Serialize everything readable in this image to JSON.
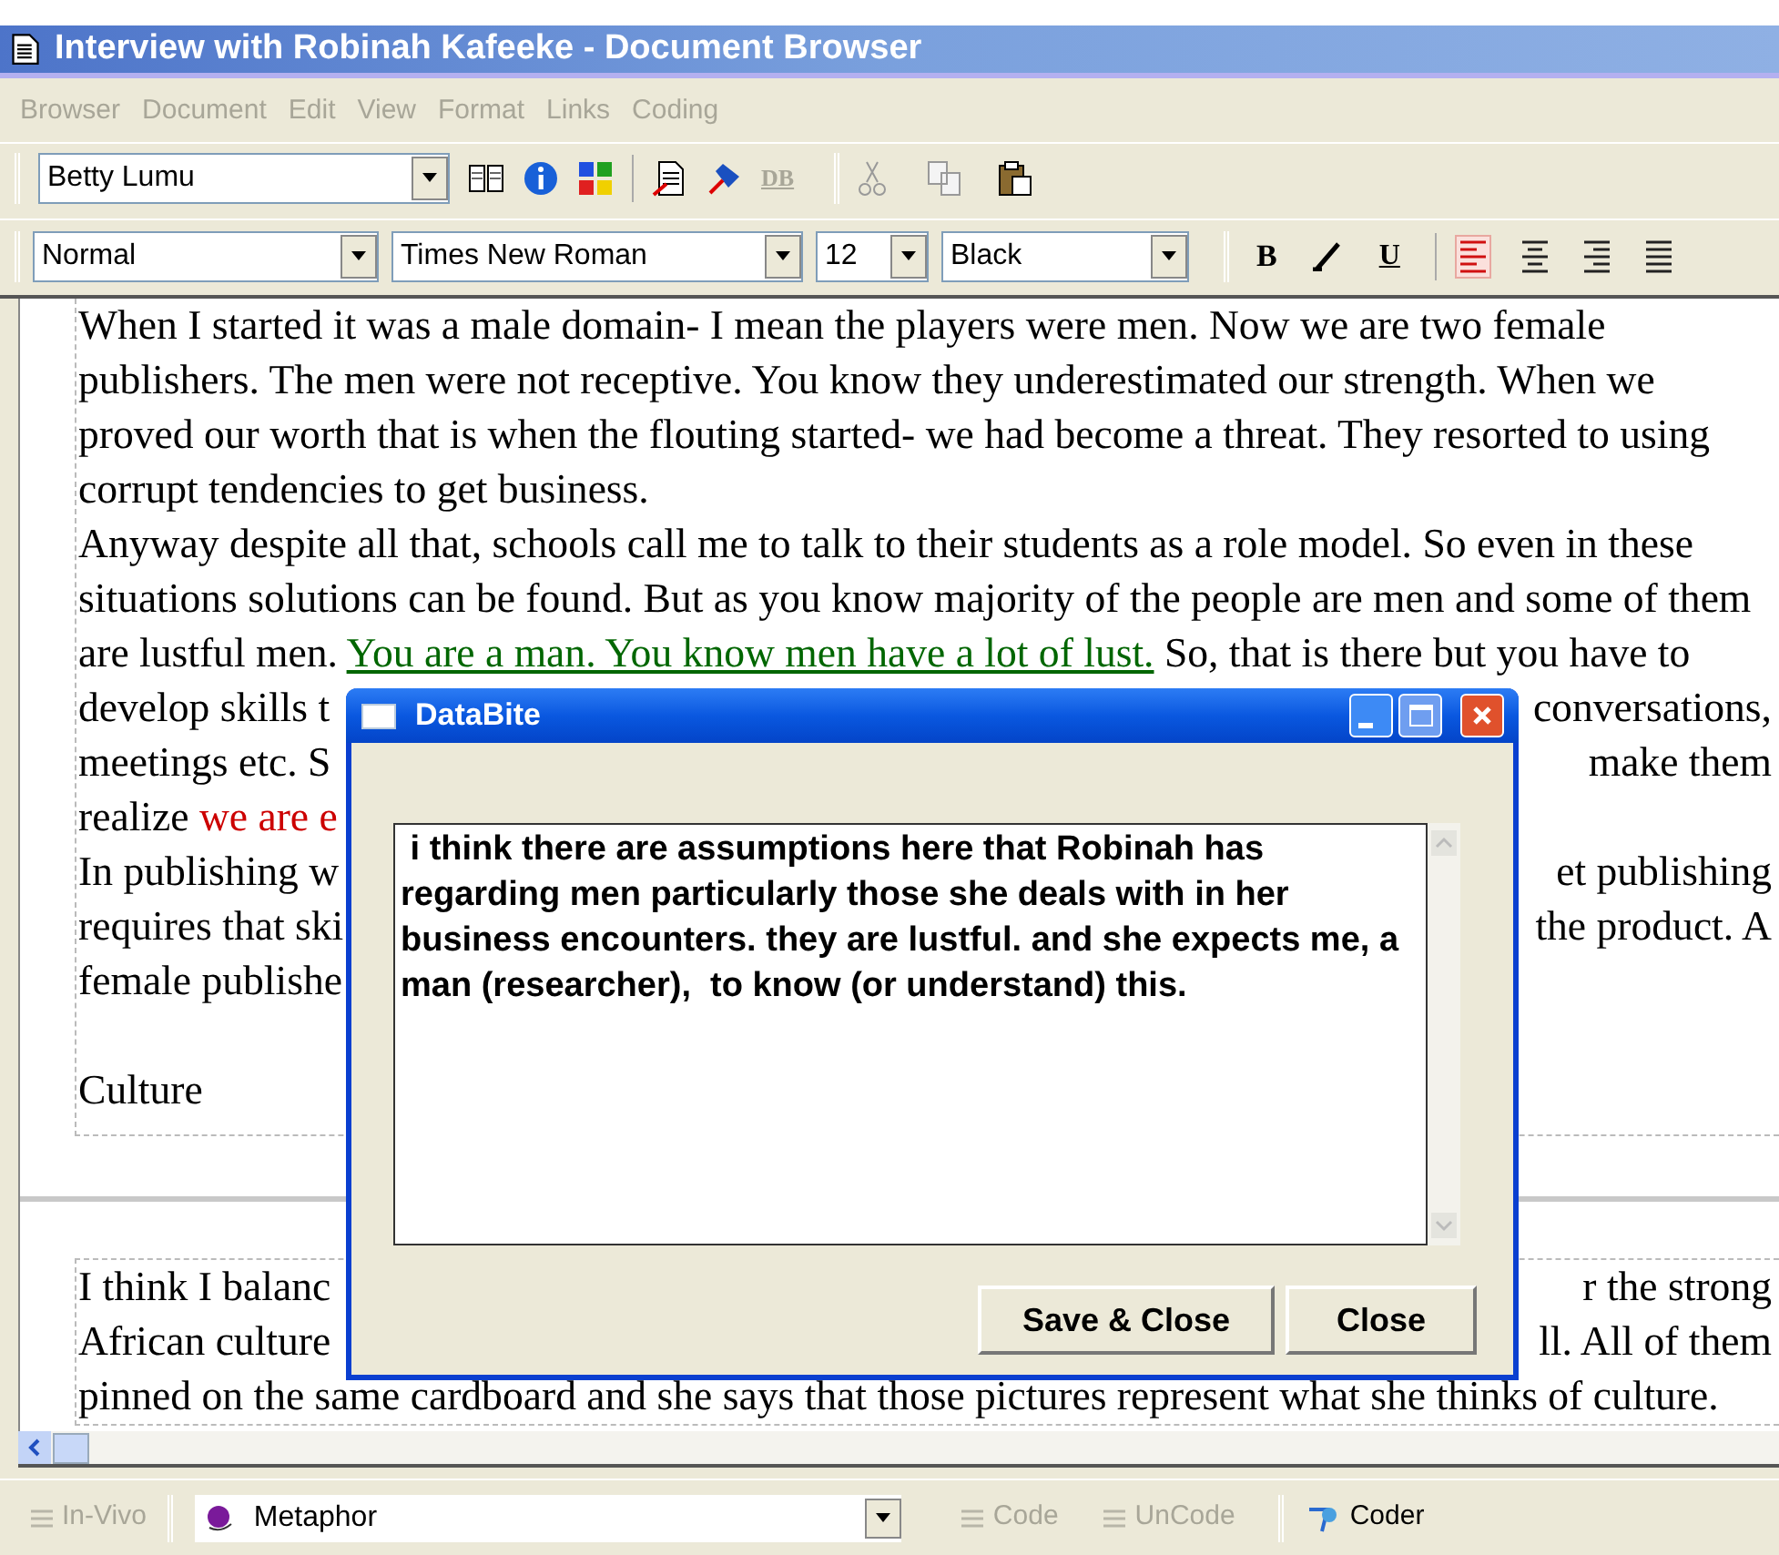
{
  "window": {
    "title": "Interview with Robinah Kafeeke - Document Browser"
  },
  "menu": [
    {
      "label": "Browser",
      "disabled": true
    },
    {
      "label": "Document",
      "disabled": true
    },
    {
      "label": "Edit",
      "disabled": true
    },
    {
      "label": "View",
      "disabled": true
    },
    {
      "label": "Format",
      "disabled": true
    },
    {
      "label": "Links",
      "disabled": true
    },
    {
      "label": "Coding",
      "disabled": true
    }
  ],
  "toolbar": {
    "user": "Betty Lumu",
    "db_button": {
      "label": "DB",
      "disabled": true
    }
  },
  "format_bar": {
    "style": "Normal",
    "font": "Times New Roman",
    "size": "12",
    "font_color_name": "Black",
    "bold": "B",
    "underline": "U",
    "alignment": [
      {
        "kind": "left",
        "selected": true
      },
      {
        "kind": "center",
        "selected": false
      },
      {
        "kind": "right",
        "selected": false
      },
      {
        "kind": "justify",
        "selected": false
      }
    ]
  },
  "document": {
    "blocks": [
      {
        "lines": [
          {
            "kind": "text",
            "left": [
              {
                "text": "When I started it was a male domain- I mean the players were men. Now we are two female"
              }
            ]
          },
          {
            "kind": "text",
            "left": [
              {
                "text": "publishers. The men were not receptive. You know they underestimated our strength. When we"
              }
            ]
          },
          {
            "kind": "text",
            "left": [
              {
                "text": "proved our worth that is when the flouting started- we had become a threat. They resorted to using"
              }
            ]
          },
          {
            "kind": "text",
            "left": [
              {
                "text": "corrupt tendencies to get business."
              }
            ]
          },
          {
            "kind": "text",
            "left": [
              {
                "text": "Anyway despite all that, schools call me to talk to their students as a role model. So even in these"
              }
            ]
          },
          {
            "kind": "text",
            "left": [
              {
                "text": "situations solutions can be found. But as you know majority of the people are men and some of them"
              }
            ]
          },
          {
            "kind": "text",
            "left": [
              {
                "text": "are lustful men. "
              },
              {
                "text": "You are a man. You know men have a lot of lust.",
                "color": "#006600"
              },
              {
                "text": " So, that is there but you have to"
              }
            ]
          },
          {
            "kind": "text",
            "left": [
              {
                "text": "develop skills t"
              }
            ],
            "right": "conversations,"
          },
          {
            "kind": "text",
            "left": [
              {
                "text": "meetings etc. S"
              }
            ],
            "right": "make them"
          },
          {
            "kind": "text",
            "left": [
              {
                "text": "realize "
              },
              {
                "text": "we are e",
                "color": "#cc0000"
              }
            ]
          },
          {
            "kind": "text",
            "left": [
              {
                "text": "In publishing w"
              }
            ],
            "right": "et publishing"
          },
          {
            "kind": "text",
            "left": [
              {
                "text": "requires that ski"
              }
            ],
            "right": "the product. A"
          },
          {
            "kind": "text",
            "left": [
              {
                "text": "female publishe"
              }
            ]
          },
          {
            "kind": "blank"
          },
          {
            "kind": "text",
            "left": [
              {
                "text": "Culture"
              }
            ]
          }
        ]
      },
      {
        "lines": [
          {
            "kind": "text",
            "left": [
              {
                "text": "I think  I balanc"
              }
            ],
            "right": "r the strong"
          },
          {
            "kind": "text",
            "left": [
              {
                "text": "African culture"
              }
            ],
            "right": "ll. All of them"
          },
          {
            "kind": "text",
            "left": [
              {
                "text": "pinned on the same cardboard and she says that those pictures represent what she thinks of culture."
              }
            ]
          }
        ]
      }
    ]
  },
  "dialog": {
    "title": "DataBite",
    "note": " i think there are assumptions here that Robinah has regarding men particularly those she deals with in her business encounters. they are lustful. and she expects me, a man (researcher),  to know (or understand) this.",
    "buttons": [
      "Save & Close",
      "Close"
    ]
  },
  "bottom_bar": {
    "in_vivo": {
      "label": "In-Vivo",
      "disabled": true
    },
    "code_list": "Metaphor",
    "actions": [
      {
        "label": "Code",
        "disabled": true
      },
      {
        "label": "UnCode",
        "disabled": true
      },
      {
        "label": "Coder",
        "disabled": false
      }
    ]
  }
}
